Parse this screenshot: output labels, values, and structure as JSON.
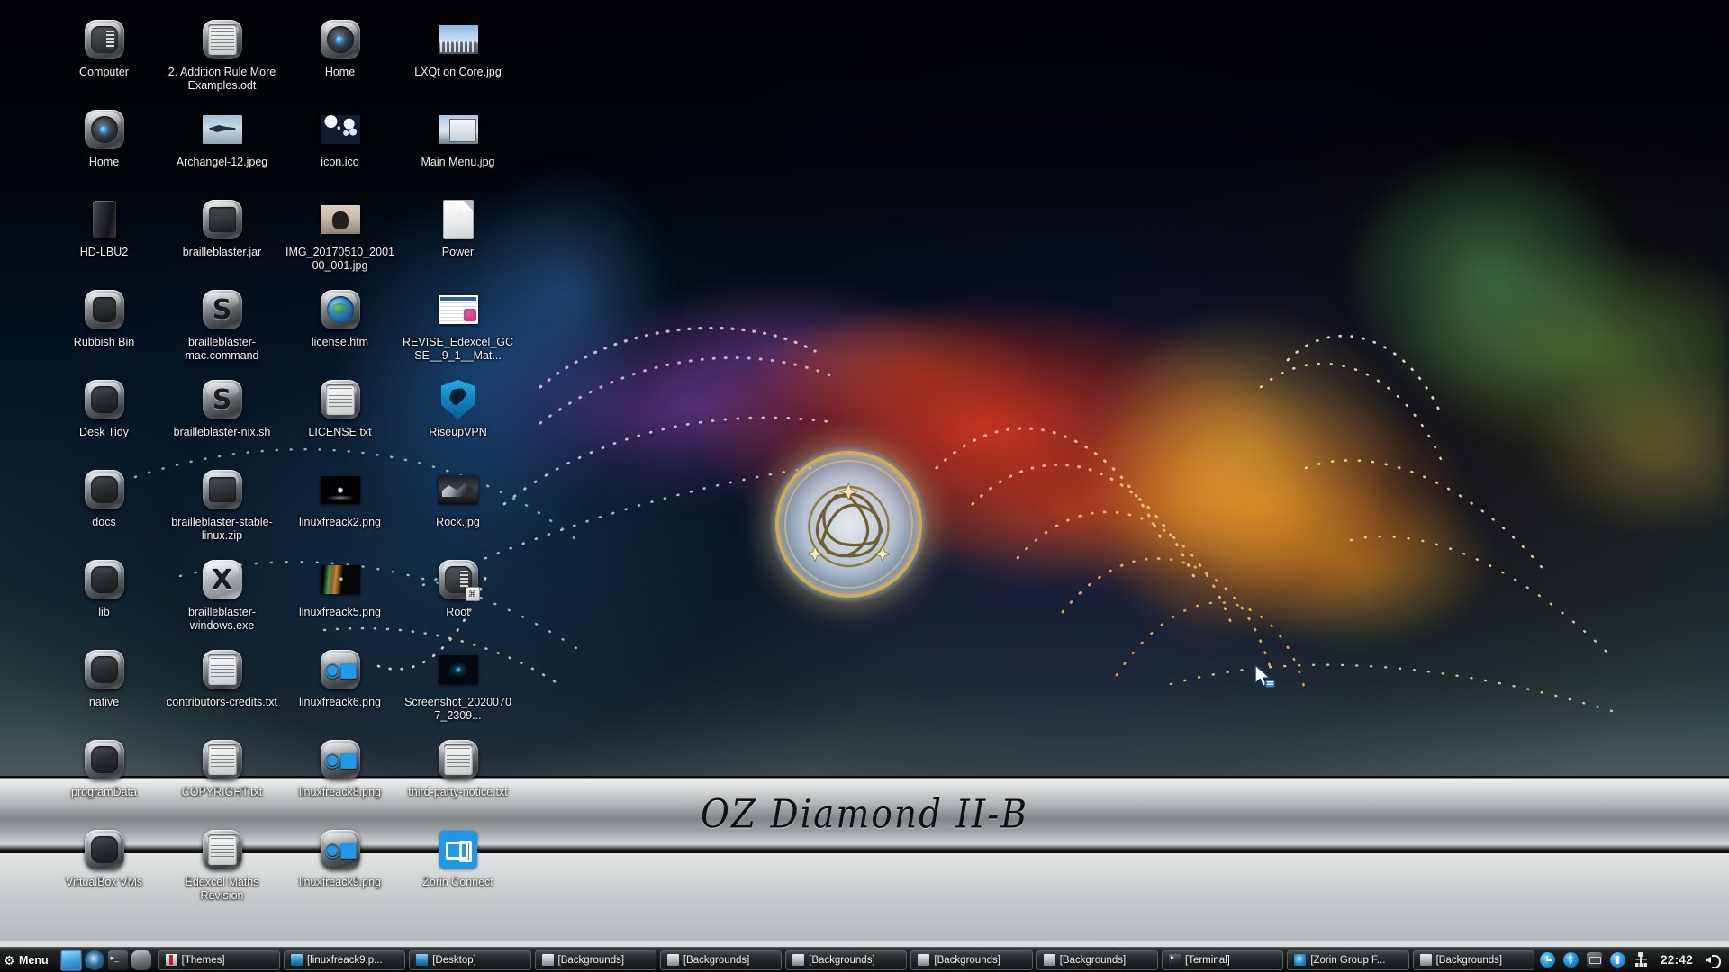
{
  "desktop": {
    "wallpaper_banner_text": "OZ Diamond II-B",
    "icons": [
      {
        "label": "Computer",
        "art": "computer"
      },
      {
        "label": "2. Addition Rule More Examples.odt",
        "art": "doc"
      },
      {
        "label": "Home",
        "art": "eye"
      },
      {
        "label": "LXQt on Core.jpg",
        "art": "photo-sky"
      },
      {
        "label": "Home",
        "art": "eye"
      },
      {
        "label": "Archangel-12.jpeg",
        "art": "photo-jet"
      },
      {
        "label": "icon.ico",
        "art": "photo-ico"
      },
      {
        "label": "Main Menu.jpg",
        "art": "photo-mainmenu"
      },
      {
        "label": "HD-LBU2",
        "art": "drive"
      },
      {
        "label": "brailleblaster.jar",
        "art": "jar"
      },
      {
        "label": "IMG_20170510_200100_001.jpg",
        "art": "photo-cat"
      },
      {
        "label": "Power",
        "art": "page"
      },
      {
        "label": "Rubbish Bin",
        "art": "trash"
      },
      {
        "label": "brailleblaster-mac.command",
        "art": "s-dark"
      },
      {
        "label": "license.htm",
        "art": "globe"
      },
      {
        "label": "REVISE_Edexcel_GCSE__9_1__Mat...",
        "art": "photo-revise"
      },
      {
        "label": "Desk Tidy",
        "art": "folder"
      },
      {
        "label": "brailleblaster-nix.sh",
        "art": "s-dark"
      },
      {
        "label": "LICENSE.txt",
        "art": "doc"
      },
      {
        "label": "RiseupVPN",
        "art": "shield"
      },
      {
        "label": "docs",
        "art": "folder"
      },
      {
        "label": "brailleblaster-stable-linux.zip",
        "art": "jar"
      },
      {
        "label": "linuxfreack2.png",
        "art": "photo-lfreak"
      },
      {
        "label": "Rock.jpg",
        "art": "photo-rock"
      },
      {
        "label": "lib",
        "art": "folder"
      },
      {
        "label": "brailleblaster-windows.exe",
        "art": "x-light"
      },
      {
        "label": "linuxfreack5.png",
        "art": "photo-lfreak5"
      },
      {
        "label": "Root",
        "art": "root"
      },
      {
        "label": "native",
        "art": "folder"
      },
      {
        "label": "contributors-credits.txt",
        "art": "doc"
      },
      {
        "label": "linuxfreack6.png",
        "art": "darktable"
      },
      {
        "label": "Screenshot_20200707_2309...",
        "art": "photo-screenshot"
      },
      {
        "label": "programData",
        "art": "folder"
      },
      {
        "label": "COPYRIGHT.txt",
        "art": "doc"
      },
      {
        "label": "linuxfreack8.png",
        "art": "darktable"
      },
      {
        "label": "third-party-notice.txt",
        "art": "doc"
      },
      {
        "label": "VirtualBox VMs",
        "art": "folder"
      },
      {
        "label": "Edexcel Maths Revision",
        "art": "doc"
      },
      {
        "label": "linuxfreack9.png",
        "art": "darktable"
      },
      {
        "label": "Zorin Connect",
        "art": "zconnect"
      }
    ]
  },
  "taskbar": {
    "menu_label": "Menu",
    "launchers": [
      {
        "name": "file-manager-launcher",
        "art": "lnch-files",
        "selected": true
      },
      {
        "name": "web-browser-launcher",
        "art": "lnch-browser",
        "selected": false
      },
      {
        "name": "terminal-launcher",
        "art": "lnch-term",
        "selected": false
      },
      {
        "name": "settings-launcher",
        "art": "lnch-other",
        "selected": false
      }
    ],
    "tasks": [
      {
        "label": "[Themes]",
        "icon": "ti-themes"
      },
      {
        "label": "[linuxfreack9.p...",
        "icon": "ti-folder-blue"
      },
      {
        "label": "[Desktop]",
        "icon": "ti-folder-blue"
      },
      {
        "label": "[Backgrounds]",
        "icon": "ti-folder-grey"
      },
      {
        "label": "[Backgrounds]",
        "icon": "ti-folder-grey"
      },
      {
        "label": "[Backgrounds]",
        "icon": "ti-folder-grey"
      },
      {
        "label": "[Backgrounds]",
        "icon": "ti-folder-grey"
      },
      {
        "label": "[Backgrounds]",
        "icon": "ti-folder-grey"
      },
      {
        "label": "[Terminal]",
        "icon": "ti-term"
      },
      {
        "label": "[Zorin Group F...",
        "icon": "ti-zorin"
      },
      {
        "label": "[Backgrounds]",
        "icon": "ti-folder-grey"
      }
    ],
    "tray": [
      {
        "name": "software-updater-tray-icon",
        "art": "tr-update"
      },
      {
        "name": "bluetooth-tray-icon",
        "art": "tr-bt"
      },
      {
        "name": "display-tray-icon",
        "art": "tr-disp"
      },
      {
        "name": "usb-device-tray-icon",
        "art": "tr-usb"
      },
      {
        "name": "network-tray-icon",
        "art": "tr-net"
      }
    ],
    "clock": "22:42",
    "volume_icon": "volume-icon"
  },
  "colors": {
    "accent": "#1c9ae8",
    "taskbar_bg": "#171819",
    "icon_label": "#f2f2f2"
  }
}
